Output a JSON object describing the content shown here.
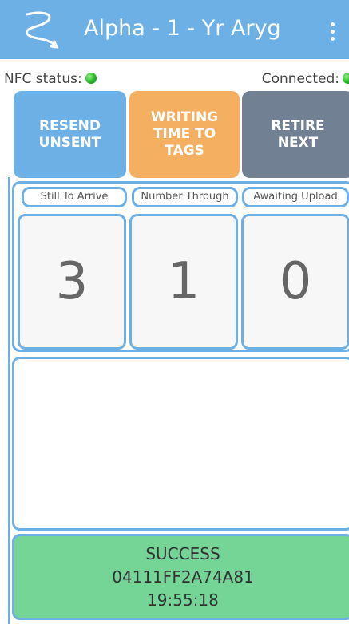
{
  "appbar": {
    "logo_icon": "signature-logo-icon",
    "title": "Alpha - 1 - Yr Aryg",
    "menu_icon": "overflow-menu-icon",
    "color": "#6db0e6"
  },
  "status": {
    "nfc_label": "NFC status:",
    "nfc_led": "green",
    "connected_label": "Connected:",
    "connected_led": "green"
  },
  "buttons": {
    "resend": "RESEND\nUNSENT",
    "writing": "WRITING\nTIME TO\nTAGS",
    "retire": "RETIRE\nNEXT",
    "colors": {
      "resend": "#6db0e6",
      "writing": "#f4b060",
      "retire": "#718093"
    }
  },
  "stats": {
    "still_to_arrive_label": "Still To Arrive",
    "still_to_arrive_value": "3",
    "number_through_label": "Number Through",
    "number_through_value": "1",
    "awaiting_upload_label": "Awaiting Upload",
    "awaiting_upload_value": "0"
  },
  "result": {
    "status": "SUCCESS",
    "tag_id": "04111FF2A74A81",
    "time": "19:55:18",
    "color": "#74d597"
  }
}
